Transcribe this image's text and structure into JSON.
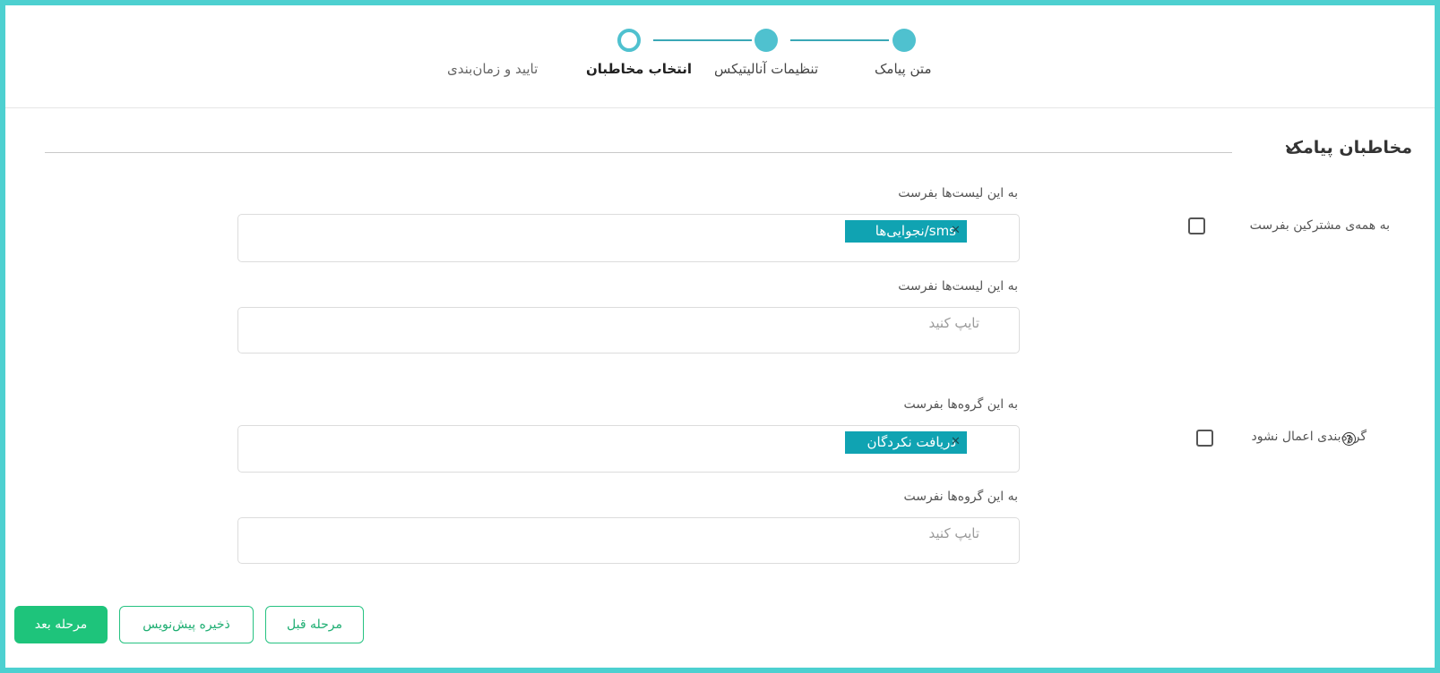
{
  "wizard": {
    "steps": [
      {
        "label": "متن پیامک",
        "status": "done"
      },
      {
        "label": "تنظیمات آنالیتیکس",
        "status": "done"
      },
      {
        "label": "انتخاب مخاطبان",
        "status": "current"
      },
      {
        "label": "تایید و زمان‌بندی",
        "status": "upcoming"
      }
    ]
  },
  "section": {
    "title": "مخاطبان پیامک"
  },
  "lists": {
    "send_label": "به این لیست‌ها بفرست",
    "send_tags": [
      {
        "label": "sms/نجوایی‌ها"
      }
    ],
    "exclude_label": "به این لیست‌ها نفرست",
    "exclude_placeholder": "تایپ کنید",
    "all_subscribers_label": "به همه‌ی مشترکین بفرست"
  },
  "groups": {
    "send_label": "به این گروه‌ها بفرست",
    "send_tags": [
      {
        "label": "دریافت نکردگان"
      }
    ],
    "exclude_label": "به این گروه‌ها نفرست",
    "exclude_placeholder": "تایپ کنید",
    "no_grouping_label": "گروه‌بندی اعمال نشود"
  },
  "footer": {
    "next_label": "مرحله بعد",
    "save_draft_label": "ذخیره پیش‌نویس",
    "prev_label": "مرحله قبل"
  },
  "colors": {
    "accent": "#4fc1cf",
    "tag": "#10a3b2",
    "primary_button": "#1ec47b",
    "frame": "#4dd0d0"
  }
}
